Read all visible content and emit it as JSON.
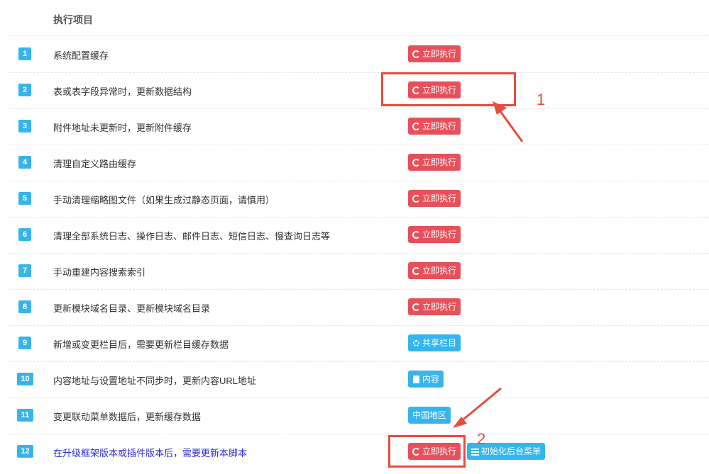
{
  "header": {
    "title": "执行项目"
  },
  "rows": [
    {
      "num": "1",
      "desc": "系统配置缓存",
      "buttons": [
        {
          "label": "立即执行",
          "icon": "refresh-icon",
          "style": "red"
        }
      ]
    },
    {
      "num": "2",
      "desc": "表或表字段异常时，更新数据结构",
      "buttons": [
        {
          "label": "立即执行",
          "icon": "refresh-icon",
          "style": "red"
        }
      ]
    },
    {
      "num": "3",
      "desc": "附件地址未更新时，更新附件缓存",
      "buttons": [
        {
          "label": "立即执行",
          "icon": "refresh-icon",
          "style": "red"
        }
      ]
    },
    {
      "num": "4",
      "desc": "清理自定义路由缓存",
      "buttons": [
        {
          "label": "立即执行",
          "icon": "refresh-icon",
          "style": "red"
        }
      ]
    },
    {
      "num": "5",
      "desc": "手动清理缩略图文件（如果生成过静态页面，请慎用）",
      "buttons": [
        {
          "label": "立即执行",
          "icon": "refresh-icon",
          "style": "red"
        }
      ]
    },
    {
      "num": "6",
      "desc": "清理全部系统日志、操作日志、邮件日志、短信日志、慢查询日志等",
      "buttons": [
        {
          "label": "立即执行",
          "icon": "refresh-icon",
          "style": "red"
        }
      ]
    },
    {
      "num": "7",
      "desc": "手动重建内容搜索索引",
      "buttons": [
        {
          "label": "立即执行",
          "icon": "refresh-icon",
          "style": "red"
        }
      ]
    },
    {
      "num": "8",
      "desc": "更新模块域名目录、更新模块域名目录",
      "buttons": [
        {
          "label": "立即执行",
          "icon": "refresh-icon",
          "style": "red"
        }
      ]
    },
    {
      "num": "9",
      "desc": "新增或变更栏目后，需要更新栏目缓存数据",
      "buttons": [
        {
          "label": "共享栏目",
          "icon": "gear-icon",
          "style": "blue"
        }
      ]
    },
    {
      "num": "10",
      "desc": "内容地址与设置地址不同步时，更新内容URL地址",
      "buttons": [
        {
          "label": "内容",
          "icon": "document-icon",
          "style": "blue"
        }
      ]
    },
    {
      "num": "11",
      "desc": "变更联动菜单数据后，更新缓存数据",
      "buttons": [
        {
          "label": "中国地区",
          "icon": "",
          "style": "blue"
        }
      ]
    },
    {
      "num": "12",
      "desc": "在升级框架版本或插件版本后，需要更新本脚本",
      "buttons": [
        {
          "label": "立即执行",
          "icon": "refresh-icon",
          "style": "red"
        },
        {
          "label": "初始化后台菜单",
          "icon": "list-icon",
          "style": "blue"
        }
      ]
    }
  ],
  "annotations": {
    "label_1": "1",
    "label_2": "2",
    "color": "#e74c3c"
  },
  "colors": {
    "red_button": "#e7505a",
    "blue_button": "#36b5ec",
    "badge": "#36b5ec",
    "link_text": "#2b2bd6"
  }
}
